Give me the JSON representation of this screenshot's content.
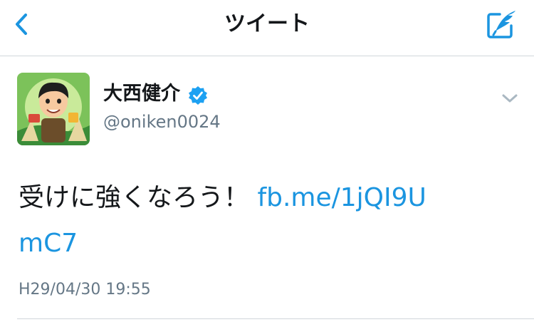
{
  "header": {
    "title": "ツイート",
    "back_icon": "chevron-left-icon",
    "compose_icon": "compose-tweet-icon",
    "accent_color": "#1b95e0"
  },
  "tweet": {
    "author": {
      "name": "大西健介",
      "handle": "@oniken0024",
      "verified": true,
      "verified_icon": "verified-badge-icon",
      "avatar_icon": "avatar-illustration"
    },
    "menu_icon": "chevron-down-icon",
    "text": "受けに強くなろう！ ",
    "link": "fb.me/1jQI9UmC7",
    "timestamp": "H29/04/30 19:55"
  }
}
